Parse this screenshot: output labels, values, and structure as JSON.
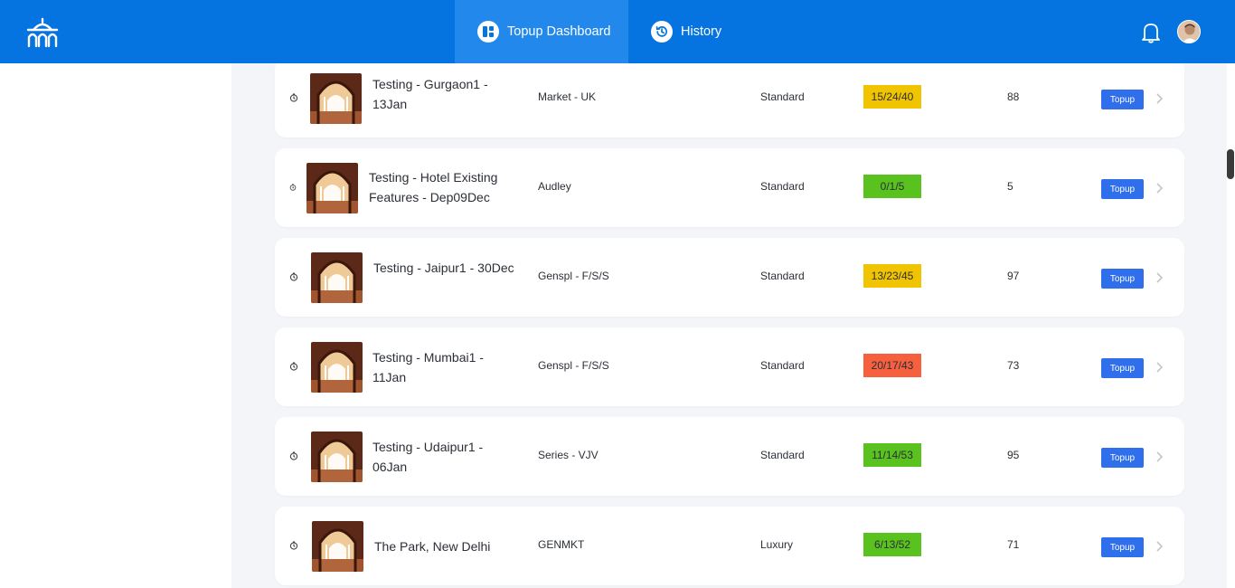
{
  "header": {
    "tabs": [
      {
        "label": "Topup Dashboard",
        "icon": "dashboard-icon",
        "active": true
      },
      {
        "label": "History",
        "icon": "history-icon",
        "active": false
      }
    ],
    "notifications_icon": "bell-icon",
    "avatar_icon": "user-avatar"
  },
  "colors": {
    "header_bg": "#0674e0",
    "active_tab_bg": "#2288ec",
    "badge_yellow": "#f0c400",
    "badge_green": "#5ac21f",
    "badge_red": "#f6603e",
    "button_blue": "#2f6fec"
  },
  "rows": [
    {
      "name": "Testing - Gurgaon1 - 13Jan",
      "market": "Market - UK",
      "category": "Standard",
      "occupancy": "15/24/40",
      "status": "yellow",
      "count": "88",
      "action": "Topup"
    },
    {
      "name": "Testing - Hotel Existing Features - Dep09Dec",
      "market": "Audley",
      "category": "Standard",
      "occupancy": "0/1/5",
      "status": "green",
      "count": "5",
      "action": "Topup"
    },
    {
      "name": "Testing - Jaipur1 - 30Dec",
      "market": "Genspl - F/S/S",
      "category": "Standard",
      "occupancy": "13/23/45",
      "status": "yellow",
      "count": "97",
      "action": "Topup"
    },
    {
      "name": "Testing - Mumbai1 - 11Jan",
      "market": "Genspl - F/S/S",
      "category": "Standard",
      "occupancy": "20/17/43",
      "status": "red",
      "count": "73",
      "action": "Topup"
    },
    {
      "name": "Testing - Udaipur1 - 06Jan",
      "market": "Series - VJV",
      "category": "Standard",
      "occupancy": "11/14/53",
      "status": "green",
      "count": "95",
      "action": "Topup"
    },
    {
      "name": "The Park, New Delhi",
      "market": "GENMKT",
      "category": "Luxury",
      "occupancy": "6/13/52",
      "status": "green",
      "count": "71",
      "action": "Topup"
    }
  ]
}
